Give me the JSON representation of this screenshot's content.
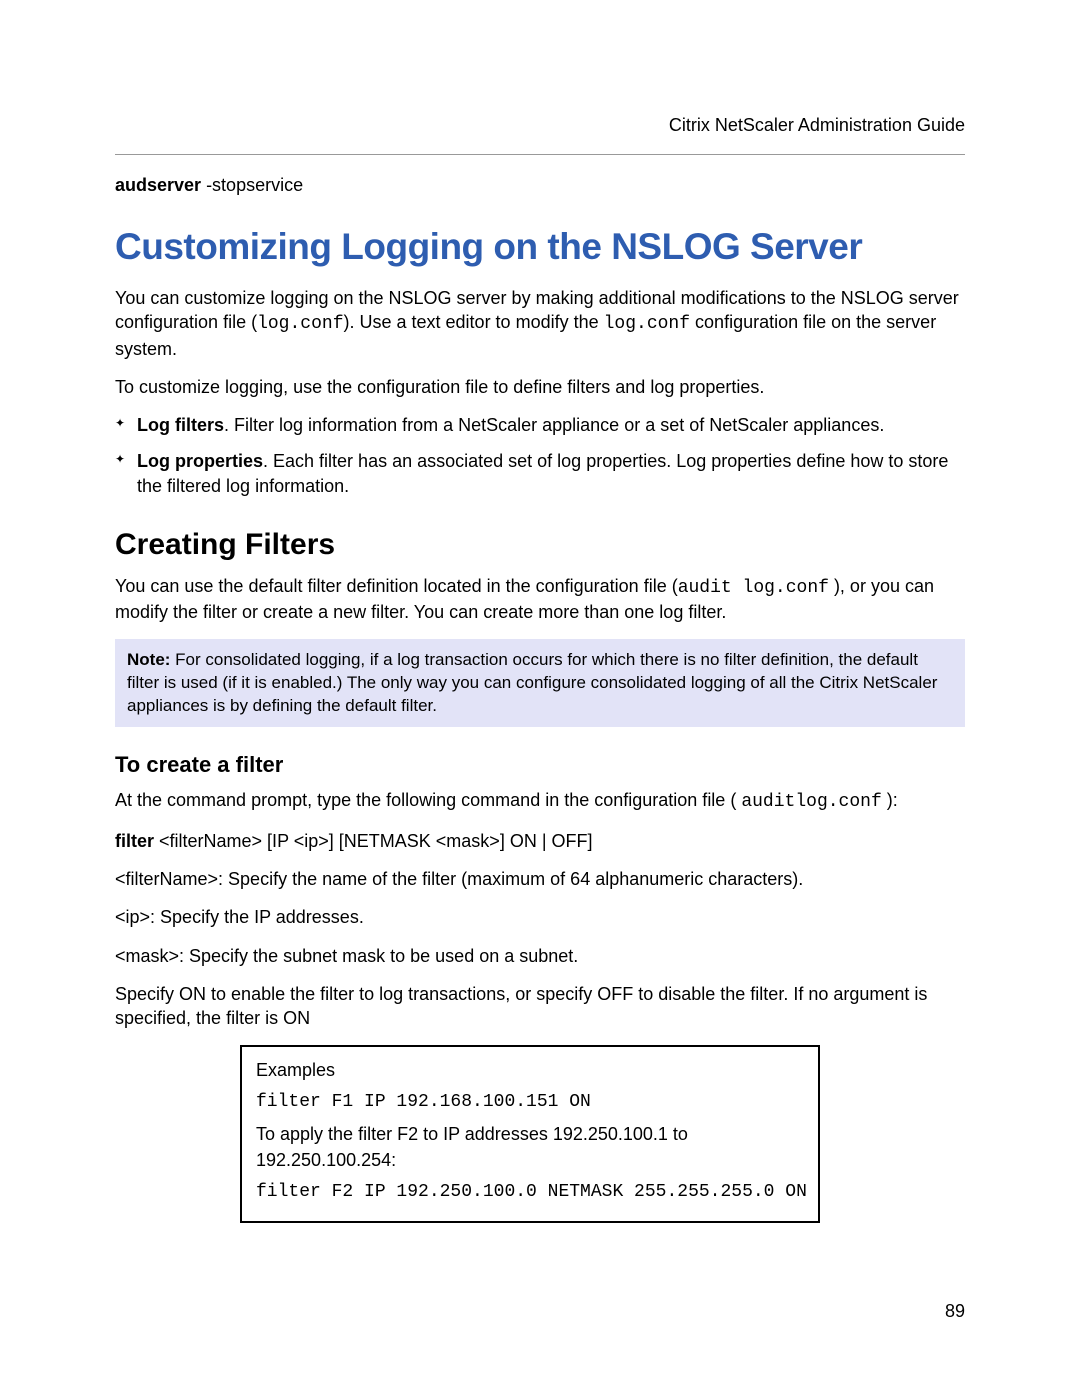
{
  "header": {
    "doc_title": "Citrix NetScaler Administration Guide"
  },
  "preamble": {
    "cmd_bold": "audserver",
    "cmd_rest": " -stopservice"
  },
  "h1": "Customizing Logging on the NSLOG Server",
  "intro": {
    "p1_a": "You can customize logging on the NSLOG server by making additional modifications to the NSLOG server configuration file (",
    "p1_code1": "log.conf",
    "p1_b": "). Use a text editor to modify the ",
    "p1_code2": "log.conf",
    "p1_c": " configuration file on the server system.",
    "p2": "To customize logging, use the configuration file to define filters and log properties."
  },
  "bullets": {
    "b1_bold": "Log filters",
    "b1_rest": ". Filter log information from a NetScaler appliance or a set of NetScaler appliances.",
    "b2_bold": "Log properties",
    "b2_rest": ". Each filter has an associated set of log properties. Log properties define how to store the filtered log information."
  },
  "h2": "Creating Filters",
  "filters": {
    "p1_a": "You can use the default filter definition located in the configuration file (",
    "p1_code1": "audit log.conf",
    "p1_b": " ), or you can modify the filter or create a new filter. You can create more than one log filter."
  },
  "note": {
    "bold": "Note:",
    "text": "  For consolidated logging, if a log transaction occurs for which there is no filter definition, the default filter is used (if it is enabled.) The only way you can configure consolidated logging of all the Citrix NetScaler appliances is by defining the default filter."
  },
  "h3": "To create a filter",
  "create": {
    "p1_a": "At the command prompt, type the following command in the configuration file ( ",
    "p1_code": "auditlog.conf",
    "p1_b": " ):",
    "syntax_bold": "filter",
    "syntax_rest": " <filterName> [IP <ip>] [NETMASK <mask>] ON | OFF]",
    "desc1": "<filterName>: Specify the name of the filter (maximum of 64 alphanumeric characters).",
    "desc2": "<ip>: Specify the IP addresses.",
    "desc3": "<mask>: Specify the subnet mask to be used on a subnet.",
    "desc4": "Specify ON to enable the filter to log transactions, or specify OFF to disable the filter. If no argument is specified, the filter is ON"
  },
  "examples": {
    "label": "Examples",
    "line1": "filter F1 IP 192.168.100.151 ON",
    "line2": "To apply the filter F2 to IP addresses 192.250.100.1 to 192.250.100.254:",
    "line3": "filter F2 IP 192.250.100.0 NETMASK 255.255.255.0 ON"
  },
  "page_number": "89"
}
